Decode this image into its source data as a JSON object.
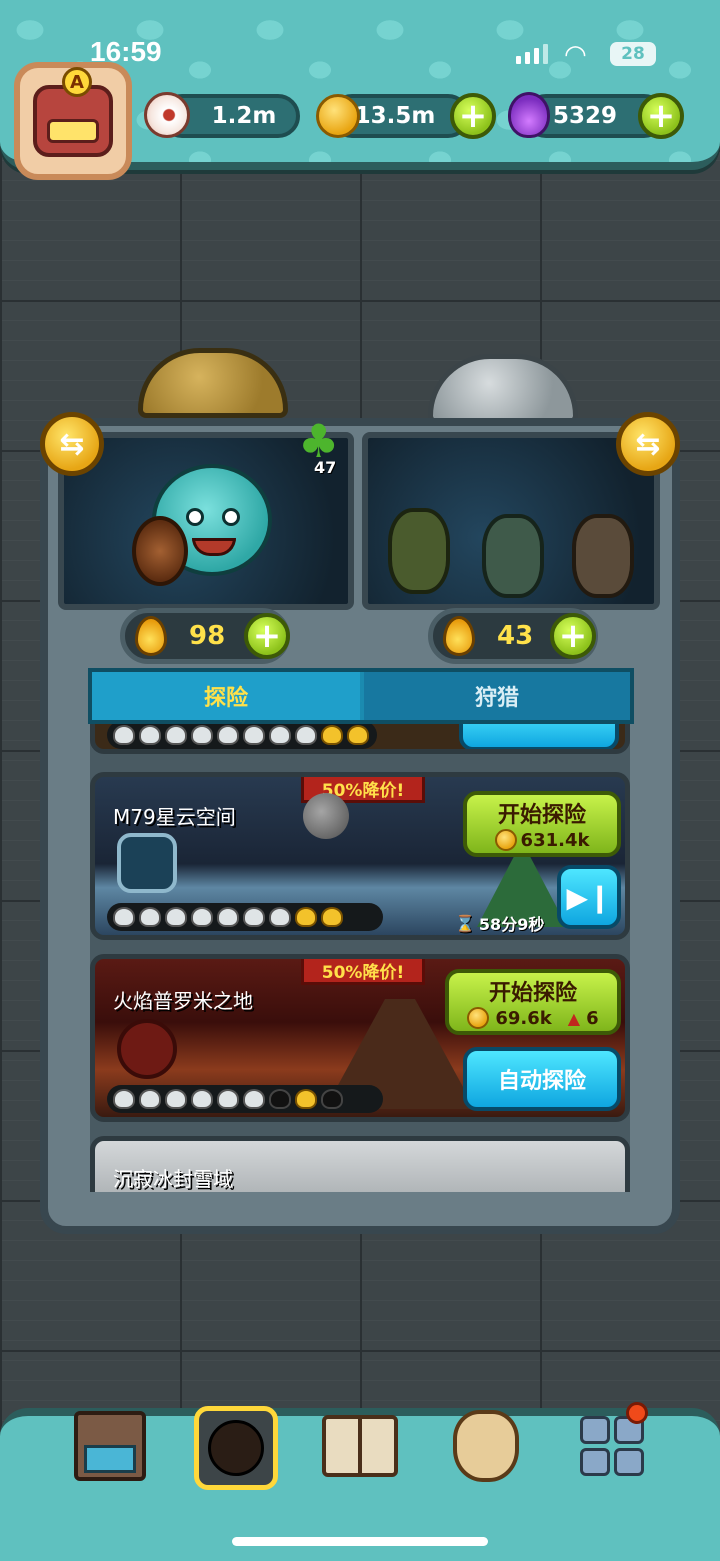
{
  "status_bar": {
    "time": "16:59",
    "battery": "28"
  },
  "currencies": {
    "eyes": {
      "icon": "eyeball-icon",
      "value": "1.2m"
    },
    "coins": {
      "icon": "coin-icon",
      "value": "13.5m"
    },
    "potions": {
      "icon": "potion-icon",
      "value": "5329"
    }
  },
  "profile": {
    "badge": "A"
  },
  "clover": {
    "count": "47"
  },
  "energy": {
    "left": "98",
    "right": "43"
  },
  "tabs": {
    "explore": "探险",
    "hunt": "狩猎"
  },
  "expeditions": [
    {
      "title": "M79星云空间",
      "sale": "50%降价!",
      "start_label": "开始探险",
      "cost": "631.4k",
      "timer": "58分9秒",
      "skulls": [
        "white",
        "white",
        "white",
        "white",
        "white",
        "white",
        "white",
        "gold",
        "gold"
      ]
    },
    {
      "title": "火焰普罗米之地",
      "sale": "50%降价!",
      "start_label": "开始探险",
      "cost": "69.6k",
      "tickets": "6",
      "auto_label": "自动探险",
      "skulls": [
        "white",
        "white",
        "white",
        "white",
        "white",
        "white",
        "dark",
        "gold",
        "dark"
      ]
    },
    {
      "title": "沉寂冰封雪域"
    }
  ],
  "colors": {
    "teal": "#5fc1bf",
    "green_button": "#9bd22a",
    "blue_button": "#18b6ee",
    "sale_red": "#b3241c"
  }
}
